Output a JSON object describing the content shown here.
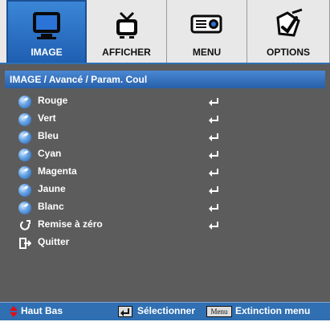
{
  "tabs": [
    {
      "label": "IMAGE",
      "icon": "monitor-icon",
      "active": true
    },
    {
      "label": "AFFICHER",
      "icon": "tv-icon",
      "active": false
    },
    {
      "label": "MENU",
      "icon": "projector-icon",
      "active": false
    },
    {
      "label": "OPTIONS",
      "icon": "tools-icon",
      "active": false
    }
  ],
  "header": {
    "title": "IMAGE / Avancé / Param. Coul"
  },
  "items": [
    {
      "label": "Rouge",
      "icon": "bullet-icon",
      "has_enter": true
    },
    {
      "label": "Vert",
      "icon": "bullet-icon",
      "has_enter": true
    },
    {
      "label": "Bleu",
      "icon": "bullet-icon",
      "has_enter": true
    },
    {
      "label": "Cyan",
      "icon": "bullet-icon",
      "has_enter": true
    },
    {
      "label": "Magenta",
      "icon": "bullet-icon",
      "has_enter": true
    },
    {
      "label": "Jaune",
      "icon": "bullet-icon",
      "has_enter": true
    },
    {
      "label": "Blanc",
      "icon": "bullet-icon",
      "has_enter": true
    },
    {
      "label": "Remise à zéro",
      "icon": "reset-icon",
      "has_enter": true
    },
    {
      "label": "Quitter",
      "icon": "exit-icon",
      "has_enter": false
    }
  ],
  "footer": {
    "nav_text": "Haut Bas",
    "select_text": "Sélectionner",
    "menu_key_label": "Menu",
    "exit_text": "Extinction menu"
  },
  "colors": {
    "osd_background": "#5c5c5c",
    "accent_blue": "#2f6fb2",
    "red_arrow": "#e01010"
  }
}
